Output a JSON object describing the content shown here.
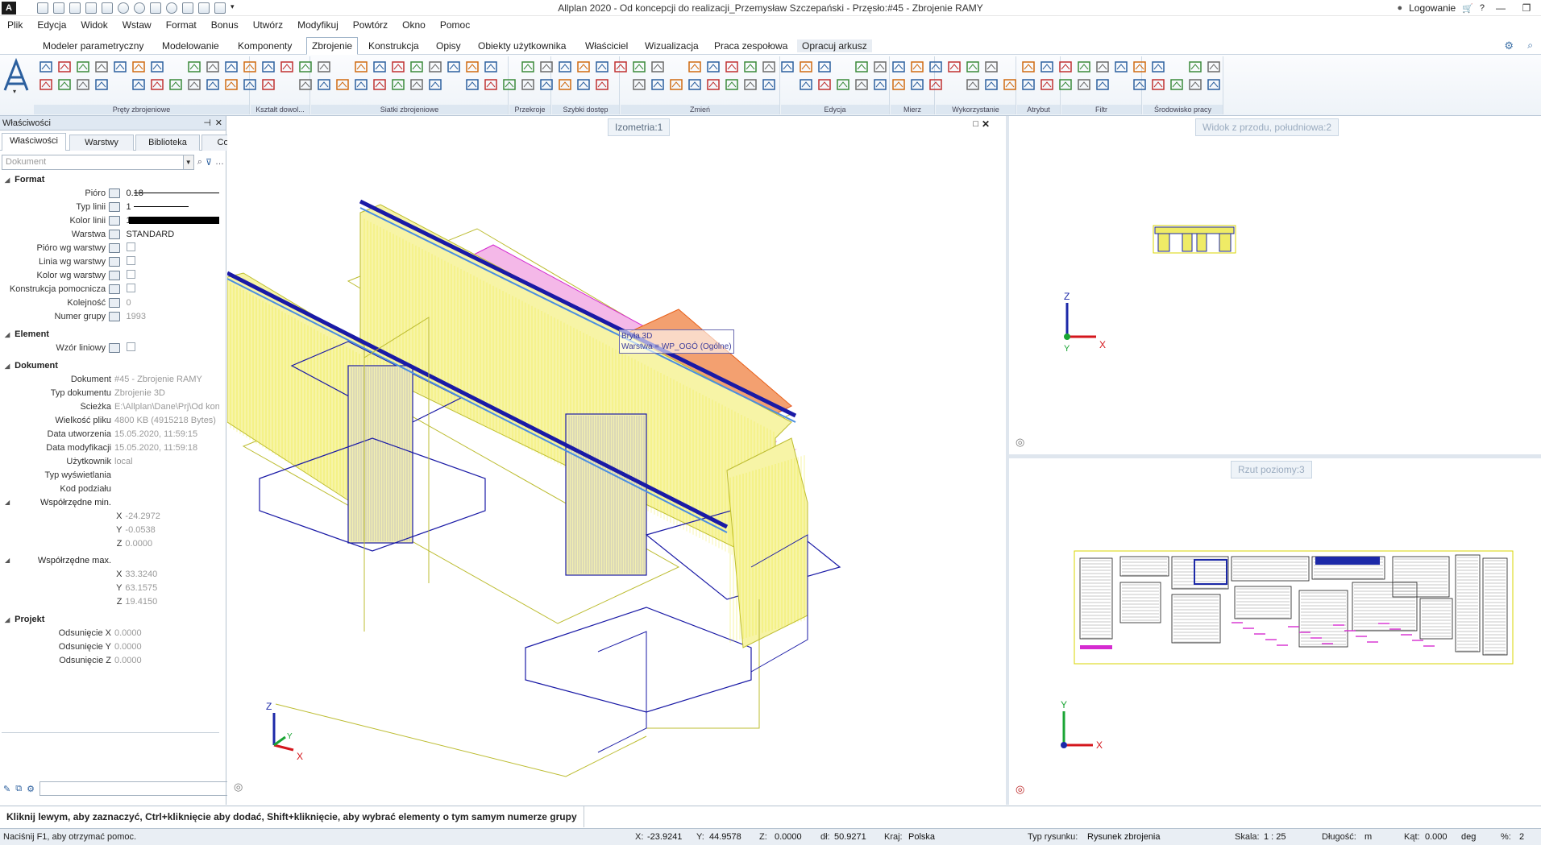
{
  "window": {
    "title": "Allplan 2020 - Od koncepcji do realizacji_Przemysław Szczepański - Przęsło:#45 - Zbrojenie RAMY",
    "login_label": "Logowanie"
  },
  "menu": [
    "Plik",
    "Edycja",
    "Widok",
    "Wstaw",
    "Format",
    "Bonus",
    "Utwórz",
    "Modyfikuj",
    "Powtórz",
    "Okno",
    "Pomoc"
  ],
  "ribbon": {
    "tabs": [
      "Modeler parametryczny",
      "Modelowanie",
      "Komponenty",
      "Zbrojenie",
      "Konstrukcja",
      "Opisy",
      "Obiekty użytkownika",
      "Właściciel",
      "Wizualizacja",
      "Praca zespołowa",
      "Opracuj arkusz"
    ],
    "active_tab": "Zbrojenie",
    "groups": [
      "Pręty zbrojeniowe",
      "Kształt dowol...",
      "Siatki zbrojeniowe",
      "Przekroje",
      "Szybki dostęp",
      "Zmień",
      "Edycja",
      "Mierz",
      "Wykorzystanie",
      "Atrybut",
      "Filtr",
      "Środowisko pracy"
    ]
  },
  "properties": {
    "panel_title": "Właściwości",
    "tabs": [
      "Właściwości",
      "Warstwy",
      "Biblioteka",
      "Connect"
    ],
    "active_tab": "Właściwości",
    "search_placeholder": "Dokument",
    "sections": {
      "format": "Format",
      "element": "Element",
      "dokument": "Dokument",
      "projekt": "Projekt"
    },
    "format_rows": [
      {
        "label": "Pióro",
        "value": "0.18"
      },
      {
        "label": "Typ linii",
        "value": "1"
      },
      {
        "label": "Kolor linii",
        "value": "1"
      },
      {
        "label": "Warstwa",
        "value": "STANDARD"
      },
      {
        "label": "Pióro wg warstwy",
        "value": ""
      },
      {
        "label": "Linia wg warstwy",
        "value": ""
      },
      {
        "label": "Kolor wg warstwy",
        "value": ""
      },
      {
        "label": "Konstrukcja pomocnicza",
        "value": ""
      },
      {
        "label": "Kolejność",
        "value": "0"
      },
      {
        "label": "Numer grupy",
        "value": "1993"
      }
    ],
    "element_rows": [
      {
        "label": "Wzór liniowy",
        "value": ""
      }
    ],
    "dokument_rows": [
      {
        "label": "Dokument",
        "value": "#45 - Zbrojenie RAMY"
      },
      {
        "label": "Typ dokumentu",
        "value": "Zbrojenie 3D"
      },
      {
        "label": "Ścieżka",
        "value": "E:\\Allplan\\Dane\\Prj\\Od koncep"
      },
      {
        "label": "Wielkość pliku",
        "value": "4800 KB (4915218 Bytes)"
      },
      {
        "label": "Data utworzenia",
        "value": "15.05.2020, 11:59:15"
      },
      {
        "label": "Data modyfikacji",
        "value": "15.05.2020, 11:59:18"
      },
      {
        "label": "Użytkownik",
        "value": "local"
      },
      {
        "label": "Typ wyświetlania",
        "value": ""
      },
      {
        "label": "Kod podziału",
        "value": ""
      }
    ],
    "min_label": "Współrzędne min.",
    "min": {
      "X": "-24.2972",
      "Y": "-0.0538",
      "Z": "0.0000"
    },
    "max_label": "Współrzędne max.",
    "max": {
      "X": "33.3240",
      "Y": "63.1575",
      "Z": "19.4150"
    },
    "projekt_rows": [
      {
        "label": "Odsunięcie X",
        "value": "0.0000"
      },
      {
        "label": "Odsunięcie Y",
        "value": "0.0000"
      },
      {
        "label": "Odsunięcie Z",
        "value": "0.0000"
      }
    ]
  },
  "viewports": {
    "iso_title": "Izometria:1",
    "front_title": "Widok z przodu, południowa:2",
    "plan_title": "Rzut poziomy:3",
    "tooltip_line1": "Bryła 3D",
    "tooltip_line2": "Warstwa = WP_OGÓ (Ogólne)",
    "axis_x": "X",
    "axis_y": "Y",
    "axis_z": "Z"
  },
  "hint": "Kliknij lewym, aby zaznaczyć, Ctrl+kliknięcie aby dodać, Shift+kliknięcie, aby wybrać elementy o tym samym numerze grupy",
  "status": {
    "help": "Naciśnij F1, aby otrzymać pomoc.",
    "x_label": "X:",
    "x": "-23.9241",
    "y_label": "Y:",
    "y": "44.9578",
    "z_label": "Z:",
    "z": "0.0000",
    "dl_label": "dł:",
    "dl": "50.9271",
    "kraj_label": "Kraj:",
    "kraj": "Polska",
    "typ_label": "Typ rysunku:",
    "typ": "Rysunek zbrojenia",
    "skala_label": "Skala:",
    "skala": "1 : 25",
    "dlug_label": "Długość:",
    "dlug": "m",
    "kat_label": "Kąt:",
    "kat": "0.000",
    "kat_unit": "deg",
    "pct_label": "%:",
    "pct": "2"
  },
  "colors": {
    "accent": "#1f5fa8",
    "rebar_blue": "#1a1aa6",
    "rebar_yellow": "#e9e400",
    "rebar_magenta": "#d52bd0",
    "rebar_orange": "#e8601a",
    "axis_red": "#d4161c",
    "axis_green": "#1aa534",
    "axis_blue": "#1c29a8"
  }
}
